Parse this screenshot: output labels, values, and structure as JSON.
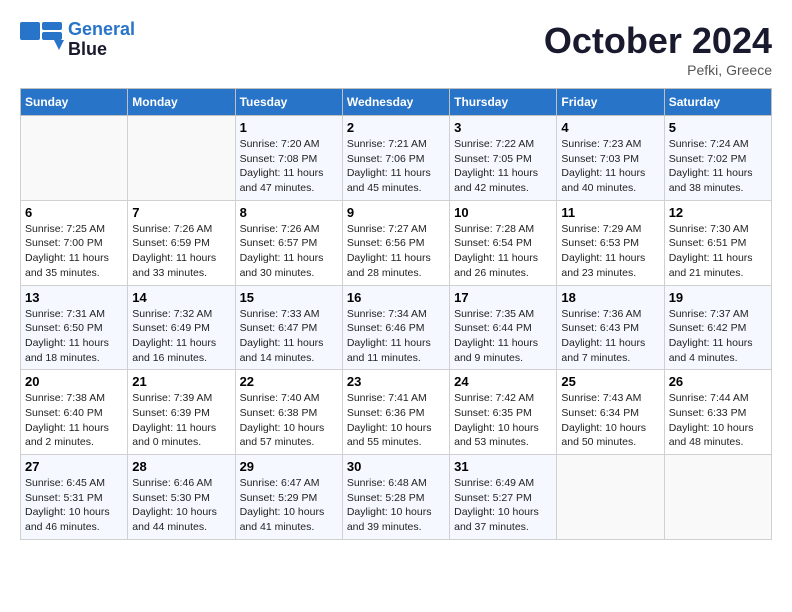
{
  "header": {
    "logo_line1": "General",
    "logo_line2": "Blue",
    "month_title": "October 2024",
    "subtitle": "Pefki, Greece"
  },
  "days_of_week": [
    "Sunday",
    "Monday",
    "Tuesday",
    "Wednesday",
    "Thursday",
    "Friday",
    "Saturday"
  ],
  "weeks": [
    [
      {
        "day": "",
        "sunrise": "",
        "sunset": "",
        "daylight": ""
      },
      {
        "day": "",
        "sunrise": "",
        "sunset": "",
        "daylight": ""
      },
      {
        "day": "1",
        "sunrise": "Sunrise: 7:20 AM",
        "sunset": "Sunset: 7:08 PM",
        "daylight": "Daylight: 11 hours and 47 minutes."
      },
      {
        "day": "2",
        "sunrise": "Sunrise: 7:21 AM",
        "sunset": "Sunset: 7:06 PM",
        "daylight": "Daylight: 11 hours and 45 minutes."
      },
      {
        "day": "3",
        "sunrise": "Sunrise: 7:22 AM",
        "sunset": "Sunset: 7:05 PM",
        "daylight": "Daylight: 11 hours and 42 minutes."
      },
      {
        "day": "4",
        "sunrise": "Sunrise: 7:23 AM",
        "sunset": "Sunset: 7:03 PM",
        "daylight": "Daylight: 11 hours and 40 minutes."
      },
      {
        "day": "5",
        "sunrise": "Sunrise: 7:24 AM",
        "sunset": "Sunset: 7:02 PM",
        "daylight": "Daylight: 11 hours and 38 minutes."
      }
    ],
    [
      {
        "day": "6",
        "sunrise": "Sunrise: 7:25 AM",
        "sunset": "Sunset: 7:00 PM",
        "daylight": "Daylight: 11 hours and 35 minutes."
      },
      {
        "day": "7",
        "sunrise": "Sunrise: 7:26 AM",
        "sunset": "Sunset: 6:59 PM",
        "daylight": "Daylight: 11 hours and 33 minutes."
      },
      {
        "day": "8",
        "sunrise": "Sunrise: 7:26 AM",
        "sunset": "Sunset: 6:57 PM",
        "daylight": "Daylight: 11 hours and 30 minutes."
      },
      {
        "day": "9",
        "sunrise": "Sunrise: 7:27 AM",
        "sunset": "Sunset: 6:56 PM",
        "daylight": "Daylight: 11 hours and 28 minutes."
      },
      {
        "day": "10",
        "sunrise": "Sunrise: 7:28 AM",
        "sunset": "Sunset: 6:54 PM",
        "daylight": "Daylight: 11 hours and 26 minutes."
      },
      {
        "day": "11",
        "sunrise": "Sunrise: 7:29 AM",
        "sunset": "Sunset: 6:53 PM",
        "daylight": "Daylight: 11 hours and 23 minutes."
      },
      {
        "day": "12",
        "sunrise": "Sunrise: 7:30 AM",
        "sunset": "Sunset: 6:51 PM",
        "daylight": "Daylight: 11 hours and 21 minutes."
      }
    ],
    [
      {
        "day": "13",
        "sunrise": "Sunrise: 7:31 AM",
        "sunset": "Sunset: 6:50 PM",
        "daylight": "Daylight: 11 hours and 18 minutes."
      },
      {
        "day": "14",
        "sunrise": "Sunrise: 7:32 AM",
        "sunset": "Sunset: 6:49 PM",
        "daylight": "Daylight: 11 hours and 16 minutes."
      },
      {
        "day": "15",
        "sunrise": "Sunrise: 7:33 AM",
        "sunset": "Sunset: 6:47 PM",
        "daylight": "Daylight: 11 hours and 14 minutes."
      },
      {
        "day": "16",
        "sunrise": "Sunrise: 7:34 AM",
        "sunset": "Sunset: 6:46 PM",
        "daylight": "Daylight: 11 hours and 11 minutes."
      },
      {
        "day": "17",
        "sunrise": "Sunrise: 7:35 AM",
        "sunset": "Sunset: 6:44 PM",
        "daylight": "Daylight: 11 hours and 9 minutes."
      },
      {
        "day": "18",
        "sunrise": "Sunrise: 7:36 AM",
        "sunset": "Sunset: 6:43 PM",
        "daylight": "Daylight: 11 hours and 7 minutes."
      },
      {
        "day": "19",
        "sunrise": "Sunrise: 7:37 AM",
        "sunset": "Sunset: 6:42 PM",
        "daylight": "Daylight: 11 hours and 4 minutes."
      }
    ],
    [
      {
        "day": "20",
        "sunrise": "Sunrise: 7:38 AM",
        "sunset": "Sunset: 6:40 PM",
        "daylight": "Daylight: 11 hours and 2 minutes."
      },
      {
        "day": "21",
        "sunrise": "Sunrise: 7:39 AM",
        "sunset": "Sunset: 6:39 PM",
        "daylight": "Daylight: 11 hours and 0 minutes."
      },
      {
        "day": "22",
        "sunrise": "Sunrise: 7:40 AM",
        "sunset": "Sunset: 6:38 PM",
        "daylight": "Daylight: 10 hours and 57 minutes."
      },
      {
        "day": "23",
        "sunrise": "Sunrise: 7:41 AM",
        "sunset": "Sunset: 6:36 PM",
        "daylight": "Daylight: 10 hours and 55 minutes."
      },
      {
        "day": "24",
        "sunrise": "Sunrise: 7:42 AM",
        "sunset": "Sunset: 6:35 PM",
        "daylight": "Daylight: 10 hours and 53 minutes."
      },
      {
        "day": "25",
        "sunrise": "Sunrise: 7:43 AM",
        "sunset": "Sunset: 6:34 PM",
        "daylight": "Daylight: 10 hours and 50 minutes."
      },
      {
        "day": "26",
        "sunrise": "Sunrise: 7:44 AM",
        "sunset": "Sunset: 6:33 PM",
        "daylight": "Daylight: 10 hours and 48 minutes."
      }
    ],
    [
      {
        "day": "27",
        "sunrise": "Sunrise: 6:45 AM",
        "sunset": "Sunset: 5:31 PM",
        "daylight": "Daylight: 10 hours and 46 minutes."
      },
      {
        "day": "28",
        "sunrise": "Sunrise: 6:46 AM",
        "sunset": "Sunset: 5:30 PM",
        "daylight": "Daylight: 10 hours and 44 minutes."
      },
      {
        "day": "29",
        "sunrise": "Sunrise: 6:47 AM",
        "sunset": "Sunset: 5:29 PM",
        "daylight": "Daylight: 10 hours and 41 minutes."
      },
      {
        "day": "30",
        "sunrise": "Sunrise: 6:48 AM",
        "sunset": "Sunset: 5:28 PM",
        "daylight": "Daylight: 10 hours and 39 minutes."
      },
      {
        "day": "31",
        "sunrise": "Sunrise: 6:49 AM",
        "sunset": "Sunset: 5:27 PM",
        "daylight": "Daylight: 10 hours and 37 minutes."
      },
      {
        "day": "",
        "sunrise": "",
        "sunset": "",
        "daylight": ""
      },
      {
        "day": "",
        "sunrise": "",
        "sunset": "",
        "daylight": ""
      }
    ]
  ]
}
